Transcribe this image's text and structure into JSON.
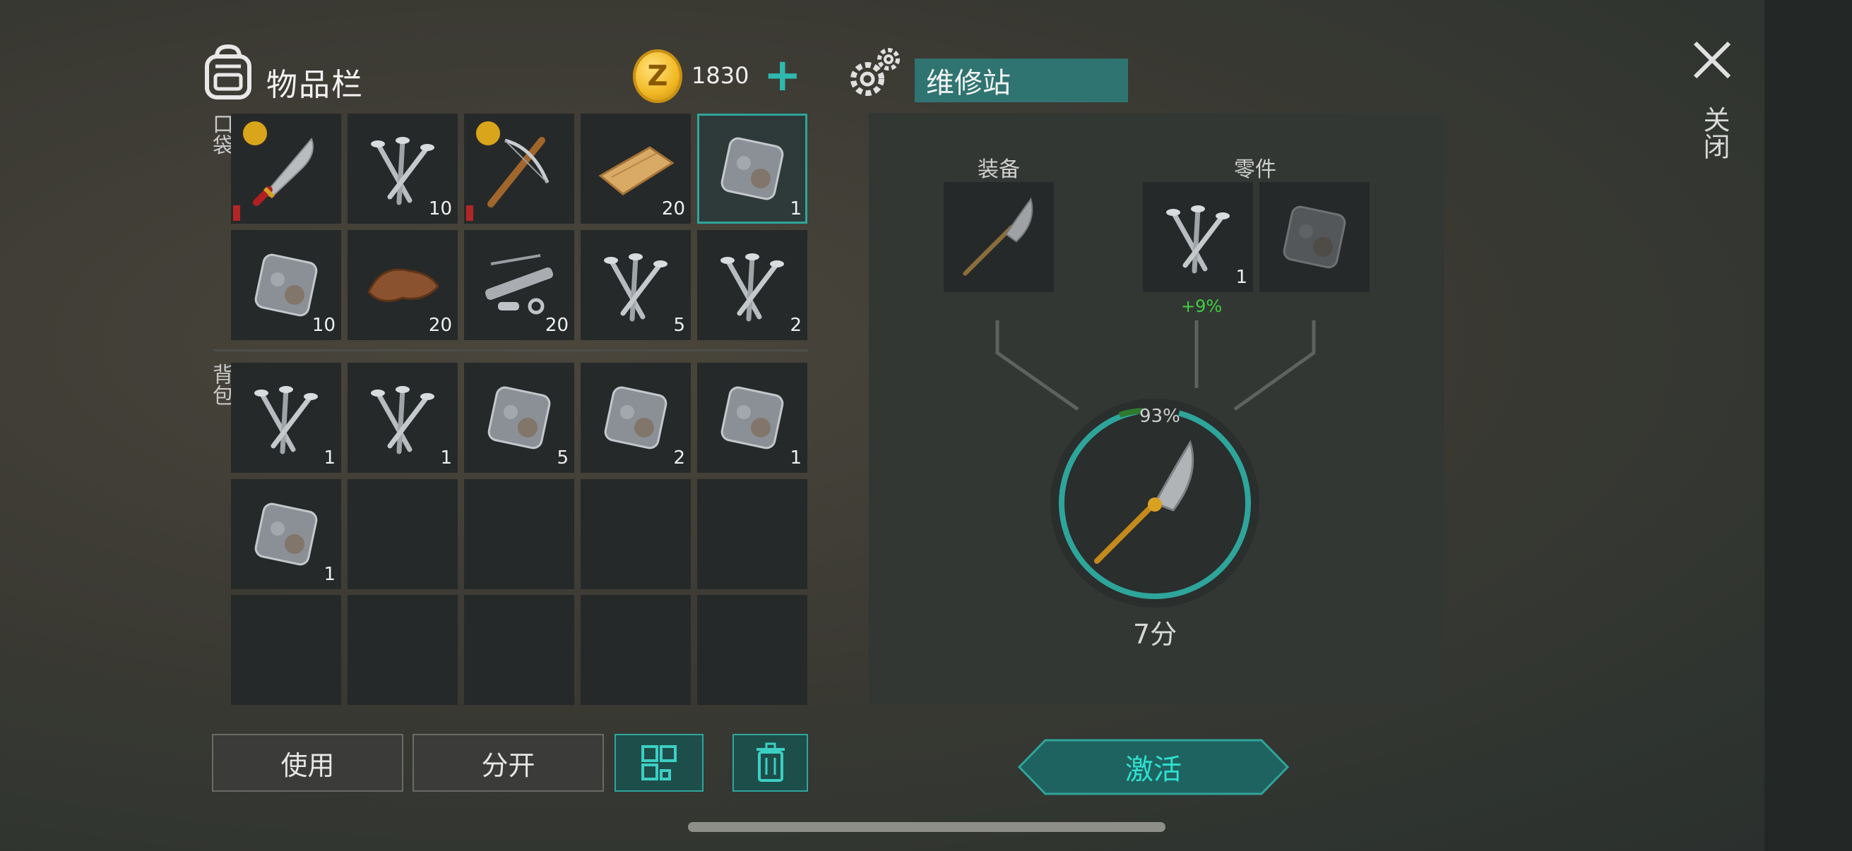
{
  "inventory": {
    "title": "物品栏",
    "coins": "1830",
    "pocket_label": "口袋",
    "backpack_label": "背包",
    "pocket_counts": [
      "",
      "10",
      "",
      "20",
      "1",
      "10",
      "20",
      "20",
      "5",
      "2"
    ],
    "backpack_counts": [
      "1",
      "1",
      "5",
      "2",
      "1",
      "1"
    ]
  },
  "buttons": {
    "use": "使用",
    "split": "分开"
  },
  "repair": {
    "title": "维修站",
    "equipment_label": "装备",
    "parts_label": "零件",
    "part_count": "1",
    "part_bonus": "+9%",
    "durability": "93%",
    "time": "7分",
    "activate": "激活"
  },
  "close_label": "关闭",
  "colors": {
    "accent": "#2ea59b",
    "title_bar": "#2f7471",
    "bonus": "#3fcf3f",
    "durability_fill": "#2ea59b"
  }
}
